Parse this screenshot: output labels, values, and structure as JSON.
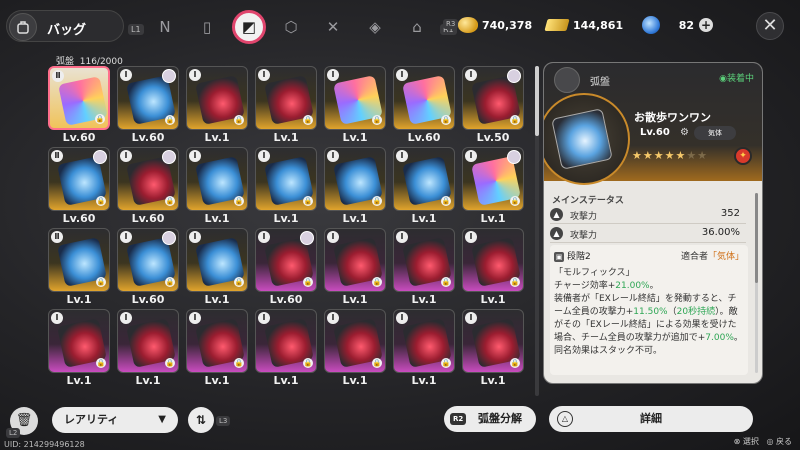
{
  "header": {
    "title": "バッグ",
    "left_hint": "L1",
    "right_hint": "R1",
    "tabs": [
      {
        "name": "tab-agent",
        "glyph": "N"
      },
      {
        "name": "tab-device",
        "glyph": "▯"
      },
      {
        "name": "tab-disc",
        "glyph": "◩"
      },
      {
        "name": "tab-box",
        "glyph": "⬡"
      },
      {
        "name": "tab-food",
        "glyph": "✕"
      },
      {
        "name": "tab-material",
        "glyph": "◈"
      },
      {
        "name": "tab-home",
        "glyph": "⌂"
      }
    ],
    "currencies": {
      "gold": "740,378",
      "ticket": "144,861",
      "orb": "82",
      "r3_hint": "R3"
    }
  },
  "inventory": {
    "title": "弧盤",
    "count": "116/2000",
    "cards": [
      {
        "lv": "Lv.60",
        "rarity": "gold",
        "disc": "multi",
        "sel": true,
        "avatar": false,
        "badge": "Ⅱ"
      },
      {
        "lv": "Lv.60",
        "rarity": "gold",
        "disc": "blue",
        "avatar": true,
        "badge": "Ⅰ"
      },
      {
        "lv": "Lv.1",
        "rarity": "gold",
        "disc": "red",
        "avatar": false,
        "badge": "Ⅰ"
      },
      {
        "lv": "Lv.1",
        "rarity": "gold",
        "disc": "red",
        "avatar": false,
        "badge": "Ⅰ"
      },
      {
        "lv": "Lv.1",
        "rarity": "gold",
        "disc": "multi",
        "avatar": false,
        "badge": "Ⅰ"
      },
      {
        "lv": "Lv.60",
        "rarity": "gold",
        "disc": "multi",
        "avatar": false,
        "badge": "Ⅰ"
      },
      {
        "lv": "Lv.50",
        "rarity": "gold",
        "disc": "red",
        "avatar": true,
        "badge": "Ⅰ"
      },
      {
        "lv": "Lv.60",
        "rarity": "gold",
        "disc": "blue",
        "avatar": true,
        "badge": "Ⅱ"
      },
      {
        "lv": "Lv.60",
        "rarity": "gold",
        "disc": "red",
        "avatar": true,
        "badge": "Ⅰ"
      },
      {
        "lv": "Lv.1",
        "rarity": "gold",
        "disc": "blue",
        "avatar": false,
        "badge": "Ⅰ"
      },
      {
        "lv": "Lv.1",
        "rarity": "gold",
        "disc": "blue",
        "avatar": false,
        "badge": "Ⅰ"
      },
      {
        "lv": "Lv.1",
        "rarity": "gold",
        "disc": "blue",
        "avatar": false,
        "badge": "Ⅰ"
      },
      {
        "lv": "Lv.1",
        "rarity": "gold",
        "disc": "blue",
        "avatar": false,
        "badge": "Ⅰ"
      },
      {
        "lv": "Lv.1",
        "rarity": "gold",
        "disc": "multi",
        "avatar": true,
        "badge": "Ⅰ"
      },
      {
        "lv": "Lv.1",
        "rarity": "gold",
        "disc": "blue",
        "avatar": false,
        "badge": "Ⅱ"
      },
      {
        "lv": "Lv.60",
        "rarity": "gold",
        "disc": "blue",
        "avatar": true,
        "badge": "Ⅰ"
      },
      {
        "lv": "Lv.1",
        "rarity": "gold",
        "disc": "blue",
        "avatar": false,
        "badge": "Ⅰ"
      },
      {
        "lv": "Lv.60",
        "rarity": "purple",
        "disc": "red",
        "avatar": true,
        "badge": "Ⅰ"
      },
      {
        "lv": "Lv.1",
        "rarity": "purple",
        "disc": "red",
        "avatar": false,
        "badge": "Ⅰ"
      },
      {
        "lv": "Lv.1",
        "rarity": "purple",
        "disc": "red",
        "avatar": false,
        "badge": "Ⅰ"
      },
      {
        "lv": "Lv.1",
        "rarity": "purple",
        "disc": "red",
        "avatar": false,
        "badge": "Ⅰ"
      },
      {
        "lv": "Lv.1",
        "rarity": "purple",
        "disc": "red",
        "avatar": false,
        "badge": "Ⅰ"
      },
      {
        "lv": "Lv.1",
        "rarity": "purple",
        "disc": "red",
        "avatar": false,
        "badge": "Ⅰ"
      },
      {
        "lv": "Lv.1",
        "rarity": "purple",
        "disc": "red",
        "avatar": false,
        "badge": "Ⅰ"
      },
      {
        "lv": "Lv.1",
        "rarity": "purple",
        "disc": "red",
        "avatar": false,
        "badge": "Ⅰ"
      },
      {
        "lv": "Lv.1",
        "rarity": "purple",
        "disc": "red",
        "avatar": false,
        "badge": "Ⅰ"
      },
      {
        "lv": "Lv.1",
        "rarity": "purple",
        "disc": "red",
        "avatar": false,
        "badge": "Ⅰ"
      },
      {
        "lv": "Lv.1",
        "rarity": "purple",
        "disc": "red",
        "avatar": false,
        "badge": "Ⅰ"
      }
    ]
  },
  "detail": {
    "category": "弧盤",
    "equipped": "◉装着中",
    "name": "お散歩ワンワン",
    "level": "Lv.60",
    "lock_label": "気体",
    "stars_filled": "★★★★★",
    "stars_empty": "★★",
    "main_stat_title": "メインステータス",
    "stats": [
      {
        "name": "攻撃力",
        "value": "352"
      },
      {
        "name": "攻撃力",
        "value": "36.00%"
      }
    ],
    "skill": {
      "stage": "段階2",
      "fit_label": "適合者",
      "fit_value": "「気体」",
      "text_1": "「モルフィックス」",
      "text_2a": "チャージ効率+",
      "text_2b": "21.00%",
      "text_2c": "。",
      "text_3a": "装備者が「EXレール終結」を発動すると、チーム全員の攻撃力+",
      "text_3b": "11.50%",
      "text_3c": "（",
      "text_3d": "20秒持続",
      "text_3e": "）。敵がその「EXレール終結」による効果を受けた場合、チーム全員の攻撃力が追加で+",
      "text_3f": "7.00%",
      "text_3g": "。同名効果はスタック不可。"
    }
  },
  "footer": {
    "trash_hint": "L2",
    "rarity_label": "レアリティ",
    "sort_hint": "L3",
    "dismantle_hint": "R2",
    "dismantle_label": "弧盤分解",
    "detail_label": "詳細",
    "uid": "UID: 214299496128",
    "select_hint": "⊗ 選択",
    "back_hint": "◎ 戻る"
  },
  "colors": {
    "accent_pink": "#e0456d",
    "gold_rarity": "#e1a42c",
    "purple_rarity": "#c94cbf",
    "highlight_green": "#2ea655"
  }
}
